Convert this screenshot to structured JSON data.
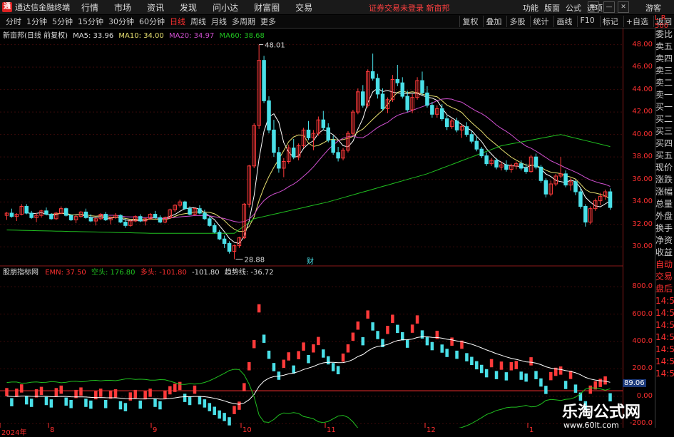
{
  "titlebar": {
    "app_title": "通达信金融终端",
    "menu": [
      "行情",
      "市场",
      "资讯",
      "发现",
      "问小达",
      "财富圈",
      "交易"
    ],
    "center_msg": "证券交易未登录  新亩邦",
    "right_menu": [
      "功能",
      "版面",
      "公式",
      "选项"
    ],
    "guest": "游客"
  },
  "toolbar": {
    "periods": [
      "分时",
      "1分钟",
      "5分钟",
      "15分钟",
      "30分钟",
      "60分钟",
      "日线",
      "周线",
      "月线",
      "多周期",
      "更多"
    ],
    "active": "日线",
    "right": [
      "复权",
      "叠加",
      "多股",
      "统计",
      "画线",
      "F10",
      "标记",
      "+自选",
      "返回"
    ]
  },
  "main_legend": {
    "name": "新亩邦(日线 前复权)",
    "ma5": "MA5: 33.96",
    "ma10": "MA10: 34.00",
    "ma20": "MA20: 34.97",
    "ma60": "MA60: 38.68"
  },
  "sub_legend": {
    "name": "股朋指标网",
    "emn": "EMN: 37.50",
    "kong": "空头: 176.80",
    "duo": "多头: -101.80",
    "v4": "-101.80",
    "trend": "趋势线: -36.72"
  },
  "annotations": {
    "high": "48.01",
    "low": "28.88",
    "cai": "财",
    "cursor_value": "89.06"
  },
  "yaxis_main": [
    "48.00",
    "46.00",
    "44.00",
    "42.00",
    "40.00",
    "38.00",
    "36.00",
    "34.00",
    "32.00",
    "30.00"
  ],
  "yaxis_sub": [
    "800.0",
    "600.0",
    "400.0",
    "200.0",
    "0.00",
    "-200.0"
  ],
  "xaxis": [
    "2024年",
    "8",
    "9",
    "10",
    "11",
    "12",
    "1"
  ],
  "right_panel_head": "L R 500",
  "right_panel": [
    "委比",
    "卖五",
    "卖四",
    "卖三",
    "卖二",
    "卖一",
    "买一",
    "买二",
    "买三",
    "买四",
    "买五",
    "现价",
    "涨跌",
    "涨幅",
    "总量",
    "外盘",
    "换手",
    "净资",
    "收益",
    "自动",
    "交易",
    "盘后",
    "14:56",
    "14:56",
    "14:56",
    "14:56",
    "14:56",
    "14:56",
    "14:56"
  ],
  "watermark": {
    "cn": "乐淘公式网",
    "url": "www.60lt.com"
  },
  "colors": {
    "up": "#ff3a3a",
    "down": "#4ae0e8",
    "ma5": "#ffffff",
    "ma10": "#e8e070",
    "ma20": "#d050d0",
    "ma60": "#20c020",
    "axis": "#ff3030"
  },
  "chart_data": {
    "type": "candlestick",
    "ylim": [
      29.0,
      48.8
    ],
    "candles": [
      [
        32.8,
        33.1,
        32.4,
        33.0
      ],
      [
        33.0,
        33.4,
        32.6,
        32.7
      ],
      [
        32.7,
        33.0,
        32.3,
        32.9
      ],
      [
        32.9,
        33.8,
        32.8,
        33.6
      ],
      [
        33.6,
        33.8,
        32.9,
        33.0
      ],
      [
        33.0,
        33.2,
        32.5,
        32.6
      ],
      [
        32.6,
        33.0,
        32.2,
        32.8
      ],
      [
        32.8,
        33.3,
        32.6,
        33.2
      ],
      [
        33.2,
        33.5,
        32.8,
        32.9
      ],
      [
        32.9,
        33.0,
        32.4,
        32.5
      ],
      [
        32.5,
        33.1,
        32.4,
        33.0
      ],
      [
        33.0,
        33.6,
        32.9,
        33.4
      ],
      [
        33.4,
        33.5,
        32.7,
        32.8
      ],
      [
        32.8,
        32.9,
        32.3,
        32.4
      ],
      [
        32.4,
        32.8,
        32.1,
        32.7
      ],
      [
        32.7,
        33.2,
        32.6,
        33.1
      ],
      [
        33.1,
        33.4,
        32.5,
        32.6
      ],
      [
        32.6,
        32.9,
        32.2,
        32.3
      ],
      [
        32.3,
        32.6,
        31.9,
        32.5
      ],
      [
        32.5,
        33.0,
        32.4,
        32.9
      ],
      [
        32.9,
        33.1,
        32.3,
        32.4
      ],
      [
        32.4,
        32.7,
        32.0,
        32.6
      ],
      [
        32.6,
        33.0,
        32.5,
        32.8
      ],
      [
        32.8,
        32.9,
        32.1,
        32.2
      ],
      [
        32.2,
        32.5,
        31.7,
        31.9
      ],
      [
        31.9,
        32.4,
        31.8,
        32.3
      ],
      [
        32.3,
        32.8,
        32.2,
        32.7
      ],
      [
        32.7,
        32.9,
        32.2,
        32.3
      ],
      [
        32.3,
        32.6,
        31.9,
        32.5
      ],
      [
        32.5,
        33.0,
        32.4,
        32.9
      ],
      [
        32.9,
        33.2,
        32.5,
        32.6
      ],
      [
        32.6,
        32.8,
        32.1,
        32.2
      ],
      [
        32.2,
        32.7,
        32.1,
        32.6
      ],
      [
        32.6,
        33.4,
        32.5,
        33.3
      ],
      [
        33.3,
        33.8,
        33.1,
        33.7
      ],
      [
        33.7,
        34.2,
        33.5,
        34.0
      ],
      [
        34.0,
        34.1,
        33.3,
        33.4
      ],
      [
        33.4,
        33.6,
        32.8,
        32.9
      ],
      [
        32.9,
        33.5,
        32.8,
        33.4
      ],
      [
        33.4,
        33.7,
        32.9,
        33.0
      ],
      [
        33.0,
        33.3,
        32.4,
        32.5
      ],
      [
        32.5,
        32.7,
        31.8,
        31.9
      ],
      [
        31.9,
        32.1,
        31.2,
        31.3
      ],
      [
        31.3,
        31.5,
        30.6,
        30.7
      ],
      [
        30.7,
        31.0,
        29.9,
        30.3
      ],
      [
        30.3,
        30.5,
        29.4,
        29.6
      ],
      [
        29.6,
        30.2,
        28.9,
        30.1
      ],
      [
        30.1,
        30.9,
        29.9,
        30.8
      ],
      [
        30.8,
        33.9,
        30.7,
        33.8
      ],
      [
        33.8,
        37.3,
        33.5,
        37.2
      ],
      [
        37.2,
        41.0,
        37.0,
        40.8
      ],
      [
        40.8,
        48.0,
        40.5,
        46.6
      ],
      [
        46.6,
        47.0,
        42.8,
        43.0
      ],
      [
        43.0,
        43.4,
        40.1,
        40.4
      ],
      [
        40.4,
        41.3,
        38.0,
        38.4
      ],
      [
        38.4,
        38.9,
        36.6,
        37.0
      ],
      [
        37.0,
        37.9,
        36.2,
        37.6
      ],
      [
        37.6,
        39.1,
        37.4,
        38.8
      ],
      [
        38.8,
        39.6,
        37.8,
        38.0
      ],
      [
        38.0,
        39.2,
        37.7,
        39.0
      ],
      [
        39.0,
        40.6,
        38.8,
        40.4
      ],
      [
        40.4,
        41.2,
        39.5,
        39.7
      ],
      [
        39.7,
        40.4,
        38.6,
        40.1
      ],
      [
        40.1,
        41.6,
        39.9,
        41.3
      ],
      [
        41.3,
        42.1,
        40.4,
        40.6
      ],
      [
        40.6,
        41.0,
        39.3,
        39.5
      ],
      [
        39.5,
        39.9,
        38.2,
        38.4
      ],
      [
        38.4,
        38.9,
        37.6,
        37.9
      ],
      [
        37.9,
        38.8,
        37.7,
        38.6
      ],
      [
        38.6,
        40.3,
        38.4,
        40.1
      ],
      [
        40.1,
        42.2,
        39.9,
        42.0
      ],
      [
        42.0,
        44.1,
        41.8,
        43.8
      ],
      [
        43.8,
        44.4,
        42.4,
        42.6
      ],
      [
        42.6,
        45.8,
        42.4,
        45.6
      ],
      [
        45.6,
        47.2,
        44.8,
        45.0
      ],
      [
        45.0,
        45.4,
        43.2,
        43.6
      ],
      [
        43.6,
        44.1,
        42.1,
        42.3
      ],
      [
        42.3,
        43.3,
        41.9,
        43.1
      ],
      [
        43.1,
        45.3,
        42.9,
        44.9
      ],
      [
        44.9,
        46.2,
        44.3,
        44.6
      ],
      [
        44.6,
        45.1,
        43.2,
        43.4
      ],
      [
        43.4,
        43.9,
        42.0,
        42.2
      ],
      [
        42.2,
        43.6,
        41.9,
        43.3
      ],
      [
        43.3,
        45.1,
        43.1,
        44.8
      ],
      [
        44.8,
        45.6,
        43.5,
        43.7
      ],
      [
        43.7,
        44.3,
        42.4,
        42.6
      ],
      [
        42.6,
        42.9,
        41.5,
        41.8
      ],
      [
        41.8,
        42.6,
        41.5,
        42.3
      ],
      [
        42.3,
        42.7,
        41.2,
        41.4
      ],
      [
        41.4,
        41.7,
        40.4,
        40.7
      ],
      [
        40.7,
        41.4,
        40.5,
        41.2
      ],
      [
        41.2,
        41.5,
        40.2,
        40.4
      ],
      [
        40.4,
        40.9,
        39.7,
        40.7
      ],
      [
        40.7,
        41.1,
        39.8,
        40.0
      ],
      [
        40.0,
        40.3,
        39.2,
        39.4
      ],
      [
        39.4,
        39.8,
        38.5,
        38.7
      ],
      [
        38.7,
        38.9,
        37.9,
        38.1
      ],
      [
        38.1,
        38.4,
        37.2,
        37.4
      ],
      [
        37.4,
        37.9,
        37.2,
        37.7
      ],
      [
        37.7,
        37.9,
        36.9,
        37.1
      ],
      [
        37.1,
        37.6,
        36.8,
        37.3
      ],
      [
        37.3,
        37.7,
        36.7,
        36.9
      ],
      [
        36.9,
        37.4,
        36.6,
        37.2
      ],
      [
        37.2,
        37.6,
        36.9,
        37.4
      ],
      [
        37.4,
        37.7,
        36.8,
        37.0
      ],
      [
        37.0,
        37.4,
        36.5,
        36.7
      ],
      [
        36.7,
        38.2,
        36.6,
        38.0
      ],
      [
        38.0,
        38.3,
        36.9,
        37.1
      ],
      [
        37.1,
        37.3,
        35.7,
        35.9
      ],
      [
        35.9,
        36.1,
        34.4,
        34.7
      ],
      [
        34.7,
        35.9,
        34.5,
        35.6
      ],
      [
        35.6,
        36.5,
        35.4,
        36.3
      ],
      [
        36.3,
        38.0,
        36.1,
        36.5
      ],
      [
        36.5,
        36.8,
        35.3,
        35.5
      ],
      [
        35.5,
        36.1,
        35.0,
        35.8
      ],
      [
        35.8,
        36.0,
        34.6,
        34.9
      ],
      [
        34.9,
        35.2,
        33.4,
        33.6
      ],
      [
        33.6,
        33.8,
        31.8,
        32.2
      ],
      [
        32.2,
        33.6,
        32.0,
        33.4
      ],
      [
        33.4,
        34.3,
        33.2,
        34.1
      ],
      [
        34.1,
        34.8,
        33.7,
        34.5
      ],
      [
        34.5,
        35.1,
        34.2,
        34.9
      ],
      [
        34.9,
        35.2,
        33.3,
        33.5
      ]
    ],
    "ma60_anchor": [
      [
        0,
        31.5
      ],
      [
        30,
        31.2
      ],
      [
        46,
        31.2
      ],
      [
        50,
        32.5
      ],
      [
        65,
        34.0
      ],
      [
        85,
        36.5
      ],
      [
        100,
        39.0
      ],
      [
        112,
        40.0
      ],
      [
        125,
        38.6
      ]
    ],
    "sub_ylim": [
      -230,
      900
    ],
    "emn": [
      0,
      0,
      0,
      0,
      0,
      0,
      0,
      0,
      0,
      0,
      0,
      0,
      0,
      0,
      0,
      0,
      0,
      0,
      0,
      0,
      0,
      0,
      0,
      0,
      0,
      0,
      0,
      0,
      0,
      0,
      0,
      0,
      0,
      0,
      0,
      0,
      0,
      0,
      0,
      0,
      0,
      0,
      0,
      0,
      0,
      0,
      0,
      0,
      0,
      0,
      0,
      0,
      0,
      0,
      0,
      0,
      0,
      0,
      0,
      0,
      0,
      0,
      0,
      0,
      0,
      0,
      0,
      0,
      0,
      0,
      0,
      0,
      0,
      0,
      0,
      0,
      0,
      0,
      0,
      0,
      0,
      0,
      0,
      0,
      0,
      0,
      0,
      0,
      0,
      0,
      0,
      0,
      0,
      0,
      0,
      0,
      0,
      0,
      0,
      0,
      0,
      0,
      0,
      0,
      0,
      0,
      0,
      0,
      0,
      0,
      0,
      0,
      0,
      0,
      0,
      0,
      0,
      0,
      0,
      0,
      0,
      0,
      0,
      0,
      0,
      0
    ],
    "note": "sub indicator derived from candles"
  }
}
